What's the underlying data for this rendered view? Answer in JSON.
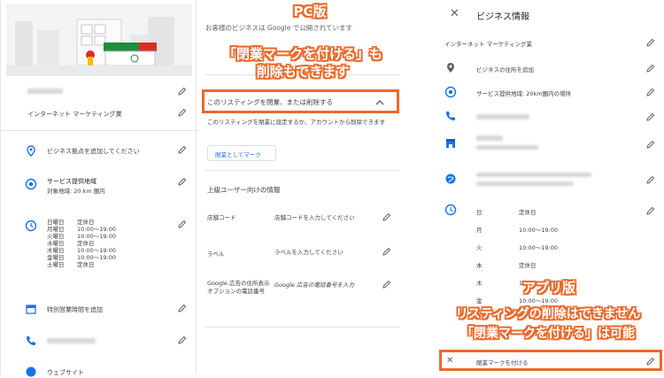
{
  "left": {
    "business_name_blur": "",
    "category": "インターネット マーケティング業",
    "add_location": "ビジネス拠点を追加してください",
    "service_area_title": "サービス提供地域",
    "service_area_value": "対象地域: 20 km 圏内",
    "hours": [
      {
        "day": "日曜日",
        "time": "定休日"
      },
      {
        "day": "月曜日",
        "time": "10:00〜19:00"
      },
      {
        "day": "火曜日",
        "time": "10:00〜19:00"
      },
      {
        "day": "水曜日",
        "time": "定休日"
      },
      {
        "day": "木曜日",
        "time": "10:00〜19:00"
      },
      {
        "day": "金曜日",
        "time": "10:00〜19:00"
      },
      {
        "day": "土曜日",
        "time": "定休日"
      }
    ],
    "special_hours": "特別営業時間を追加",
    "website": "ウェブサイト"
  },
  "middle": {
    "top_text": "お客様のビジネスは Google で公開されています",
    "listing_close_header": "このリスティングを閉業、または削除する",
    "listing_close_desc": "このリスティングを閉業に設定するか、アカウントから削除できます",
    "mark_closed_button": "閉業としてマーク",
    "advanced_title": "上級ユーザー向けの情報",
    "rows": [
      {
        "label": "店舗コード",
        "value": "店舗コードを入力してください"
      },
      {
        "label": "ラベル",
        "value": "ラベルを入力してください"
      },
      {
        "label": "Google 広告の住所表示オプションの電話番号",
        "value": "Google 広告の電話番号を入力"
      }
    ]
  },
  "right": {
    "title": "ビジネス情報",
    "category": "インターネット マーケティング業",
    "add_address": "ビジネスの住所を追加",
    "service_area": "サービス提供地域: 20km圏内の場所",
    "hours": [
      {
        "day": "日",
        "time": "定休日"
      },
      {
        "day": "月",
        "time": "10:00〜19:00"
      },
      {
        "day": "火",
        "time": "10:00〜19:00"
      },
      {
        "day": "水",
        "time": "定休日"
      },
      {
        "day": "木",
        "time": "10:00〜19:00"
      },
      {
        "day": "金",
        "time": "10:00〜19:00"
      }
    ],
    "mark_closed": "閉業マークを付ける"
  },
  "annotations": {
    "pc_label": "PC版",
    "pc_line1": "「閉業マークを付ける」も",
    "pc_line2": "削除もできます",
    "app_label": "アプリ版",
    "app_line1": "リスティングの削除はできません",
    "app_line2": "「閉業マークを付ける」は可能"
  },
  "colors": {
    "accent": "#ea6a2c",
    "blue": "#1a73e8"
  }
}
